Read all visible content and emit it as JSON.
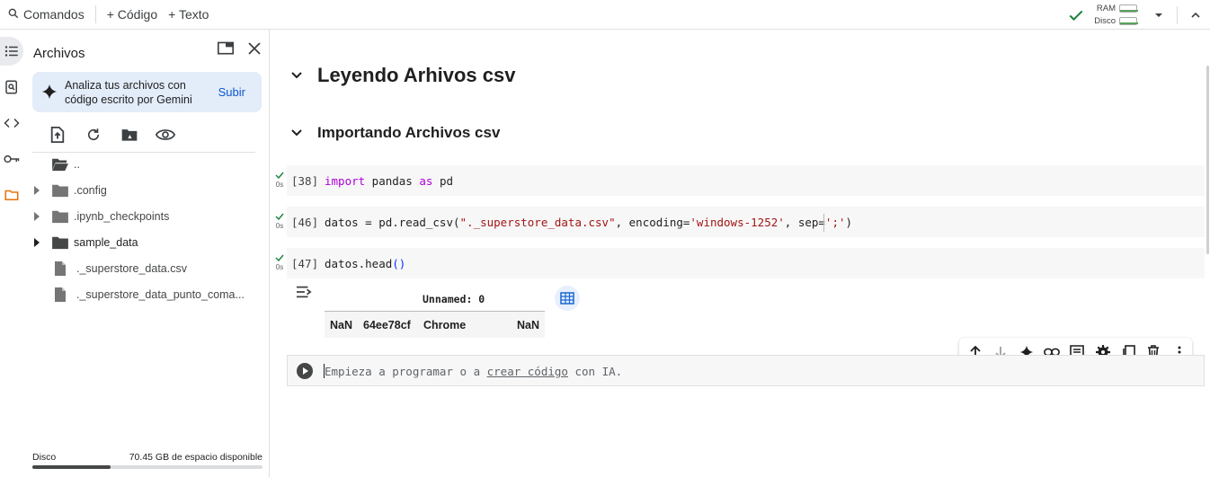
{
  "toolbar": {
    "commands_label": "Comandos",
    "add_code_label": "+ Código",
    "add_text_label": "+ Texto",
    "ram_label": "RAM",
    "disk_label": "Disco"
  },
  "files_panel": {
    "title": "Archivos",
    "gemini_text_line1": "Analiza tus archivos con",
    "gemini_text_line2": "código escrito por Gemini",
    "gemini_button": "Subir",
    "items": [
      {
        "label": "..",
        "type": "folder-open",
        "expandable": false
      },
      {
        "label": ".config",
        "type": "folder",
        "expandable": true
      },
      {
        "label": ".ipynb_checkpoints",
        "type": "folder",
        "expandable": true
      },
      {
        "label": "sample_data",
        "type": "folder-dark",
        "expandable": true
      },
      {
        "label": "._superstore_data.csv",
        "type": "file",
        "expandable": false
      },
      {
        "label": "._superstore_data_punto_coma...",
        "type": "file",
        "expandable": false
      }
    ],
    "disk_label": "Disco",
    "disk_free": "70.45 GB de espacio disponible",
    "disk_used_fraction": 0.34
  },
  "notebook": {
    "heading1": "Leyendo Arhivos csv",
    "heading2": "Importando Archivos csv",
    "cells": [
      {
        "num": "[38]",
        "time": "0s",
        "code_kw": "import",
        "code_rest1": " pandas ",
        "code_kw2": "as",
        "code_rest2": " pd"
      },
      {
        "num": "[46]",
        "time": "0s",
        "code_a": "datos = pd.read_csv(",
        "code_str1": "\"._superstore_data.csv\"",
        "code_b": ", encoding=",
        "code_str2": "'windows-1252'",
        "code_c": ", sep=",
        "code_str3": "';'",
        "code_d": ")"
      },
      {
        "num": "[47]",
        "time": "0s",
        "code_a": "datos.head",
        "code_paren": "()"
      }
    ],
    "dataframe": {
      "column_header": "Unnamed: 0",
      "row": [
        "NaN",
        "64ee78cf",
        "Chrome",
        "NaN"
      ]
    },
    "empty_cell": {
      "prefix": "Empieza a programar o a ",
      "link": "crear código",
      "suffix": " con IA."
    }
  }
}
